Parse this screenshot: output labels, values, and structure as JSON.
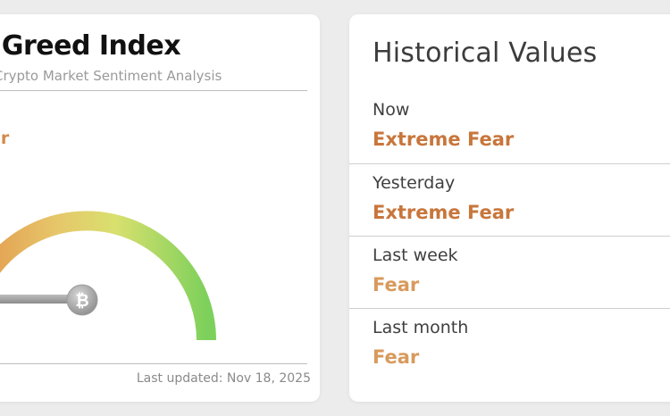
{
  "left_card": {
    "title": "r & Greed Index",
    "subtitle": "Crypto Market Sentiment Analysis",
    "current_label": "ar",
    "last_updated": "Last updated: Nov 18, 2025"
  },
  "right_card": {
    "title": "Historical Values",
    "rows": [
      {
        "label": "Now",
        "value": "Extreme Fear",
        "color": "#c8763c"
      },
      {
        "label": "Yesterday",
        "value": "Extreme Fear",
        "color": "#c8763c"
      },
      {
        "label": "Last week",
        "value": "Fear",
        "color": "#d89a5c"
      },
      {
        "label": "Last month",
        "value": "Fear",
        "color": "#d89a5c"
      }
    ]
  },
  "colors": {
    "extreme_fear": "#c8763c",
    "fear": "#d89a5c",
    "gauge_green": "#7ed05c",
    "gauge_yellow": "#e6dc6a",
    "gauge_orange": "#e39a4e"
  },
  "icons": {
    "needle_hub": "bitcoin-icon"
  }
}
